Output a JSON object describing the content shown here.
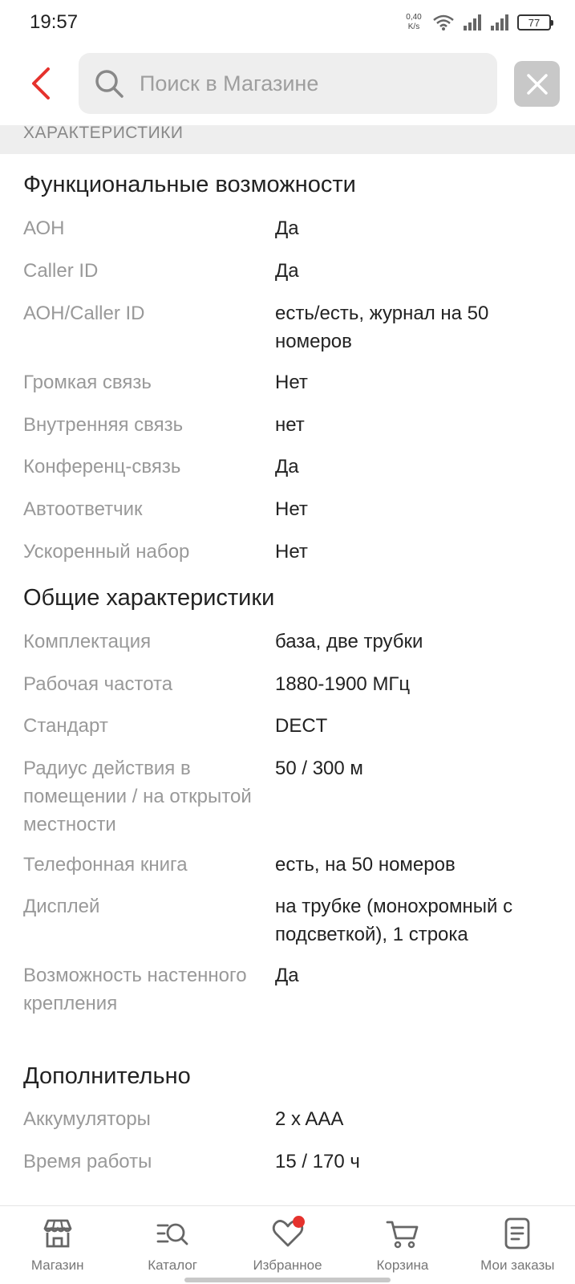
{
  "status_bar": {
    "time": "19:57",
    "net_speed_value": "0,40",
    "net_speed_unit": "K/s",
    "battery": "77"
  },
  "header": {
    "search_placeholder": "Поиск в Магазине"
  },
  "section": {
    "label": "ХАРАКТЕРИСТИКИ"
  },
  "groups": {
    "functions": {
      "title": "Функциональные возможности",
      "rows": [
        {
          "label": "АОН",
          "value": "Да"
        },
        {
          "label": "Caller ID",
          "value": "Да"
        },
        {
          "label": "АОН/Caller ID",
          "value": "есть/есть, журнал на 50 номеров"
        },
        {
          "label": "Громкая связь",
          "value": "Нет"
        },
        {
          "label": "Внутренняя связь",
          "value": "нет"
        },
        {
          "label": "Конференц-связь",
          "value": "Да"
        },
        {
          "label": "Автоответчик",
          "value": "Нет"
        },
        {
          "label": "Ускоренный набор",
          "value": "Нет"
        }
      ]
    },
    "general": {
      "title": "Общие характеристики",
      "rows": [
        {
          "label": "Комплектация",
          "value": "база, две трубки"
        },
        {
          "label": "Рабочая частота",
          "value": "1880-1900 МГц"
        },
        {
          "label": "Стандарт",
          "value": "DECT"
        },
        {
          "label": "Радиус действия в помещении / на открытой местности",
          "value": "50 / 300 м"
        },
        {
          "label": "Телефонная книга",
          "value": "есть, на 50 номеров"
        },
        {
          "label": "Дисплей",
          "value": "на трубке (монохромный с подсветкой), 1 строка"
        },
        {
          "label": "Возможность настенного крепления",
          "value": "Да"
        }
      ]
    },
    "extra": {
      "title": "Дополнительно",
      "rows": [
        {
          "label": "Аккумуляторы",
          "value": "2 x AAA"
        },
        {
          "label": "Время работы",
          "value": "15 / 170 ч"
        }
      ]
    }
  },
  "bottom_nav": {
    "items": [
      {
        "label": "Магазин",
        "icon": "store-icon"
      },
      {
        "label": "Каталог",
        "icon": "catalog-search-icon"
      },
      {
        "label": "Избранное",
        "icon": "heart-icon"
      },
      {
        "label": "Корзина",
        "icon": "cart-icon"
      },
      {
        "label": "Мои заказы",
        "icon": "orders-icon"
      }
    ]
  },
  "colors": {
    "accent": "#e5322d",
    "label_gray": "#999999",
    "search_bg": "#eeeeee"
  }
}
